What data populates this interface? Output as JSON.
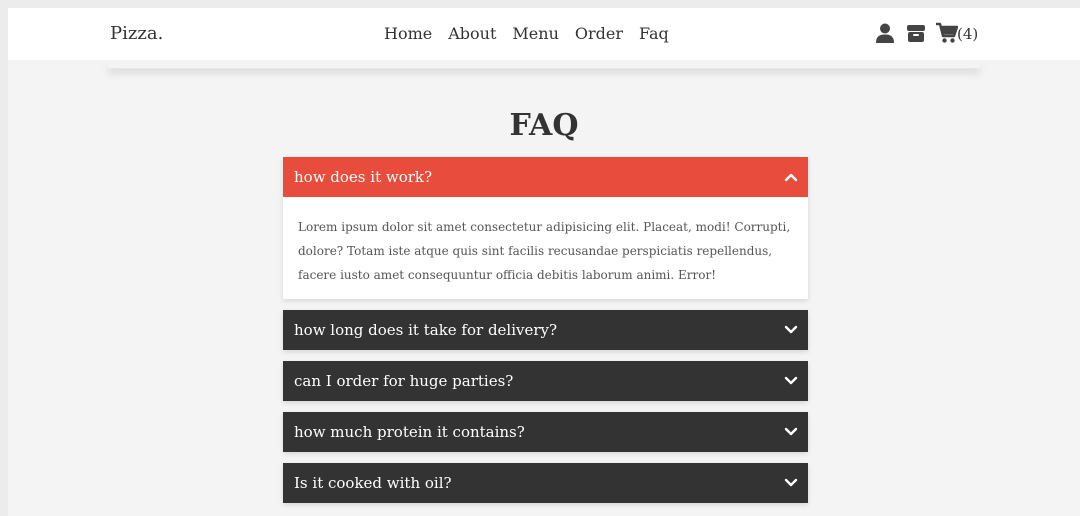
{
  "header": {
    "logo": "Pizza.",
    "nav": [
      "Home",
      "About",
      "Menu",
      "Order",
      "Faq"
    ],
    "icons": [
      "user-icon",
      "box-icon",
      "cart-icon"
    ],
    "cart_count": "(4)"
  },
  "faq": {
    "title": "FAQ",
    "items": [
      {
        "question": "how does it work?",
        "answer": "Lorem ipsum dolor sit amet consectetur adipisicing elit. Placeat, modi! Corrupti, dolore? Totam iste atque quis sint facilis recusandae perspiciatis repellendus, facere iusto amet consequuntur officia debitis laborum animi. Error!",
        "expanded": true
      },
      {
        "question": "how long does it take for delivery?",
        "expanded": false
      },
      {
        "question": "can I order for huge parties?",
        "expanded": false
      },
      {
        "question": "how much protein it contains?",
        "expanded": false
      },
      {
        "question": "Is it cooked with oil?",
        "expanded": false
      }
    ]
  },
  "colors": {
    "accent": "#e74c3c",
    "dark": "#333333",
    "background": "#f4f4f4"
  }
}
